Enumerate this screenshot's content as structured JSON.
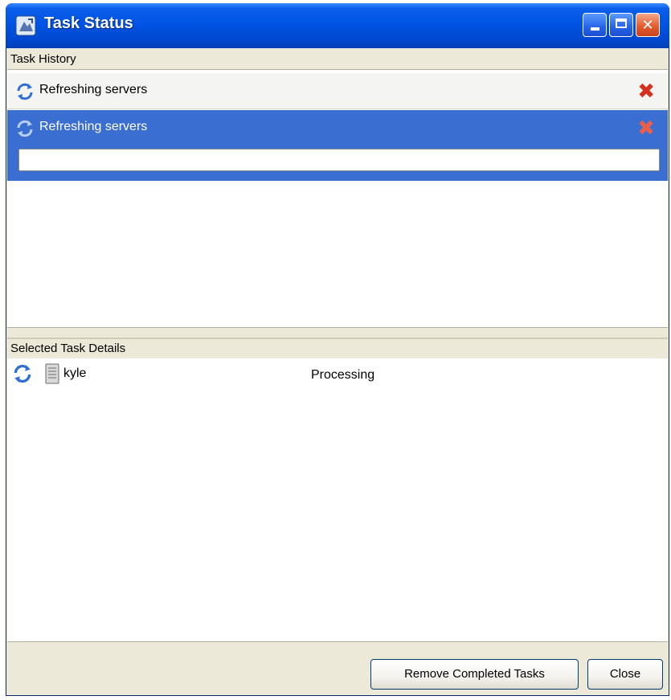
{
  "window": {
    "title": "Task Status"
  },
  "task_history": {
    "header": "Task History",
    "rows": [
      {
        "label": "Refreshing servers",
        "selected": false,
        "icon": "refresh-icon",
        "action_icon": "remove-icon"
      },
      {
        "label": "Refreshing servers",
        "selected": true,
        "icon": "refresh-icon",
        "action_icon": "remove-icon",
        "progress": 0
      }
    ]
  },
  "task_details": {
    "header": "Selected Task Details",
    "rows": [
      {
        "name": "kyle",
        "status": "Processing",
        "icons": [
          "refresh-icon",
          "server-icon"
        ]
      }
    ]
  },
  "buttons": {
    "remove_completed": "Remove Completed Tasks",
    "close": "Close"
  },
  "colors": {
    "titlebar": "#0054e3",
    "selection": "#3a6fd1",
    "remove_x": "#d62f1c"
  }
}
